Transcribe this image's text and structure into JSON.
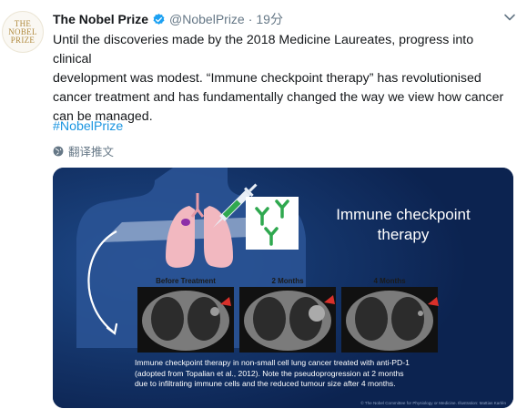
{
  "tweet": {
    "avatar_lines": [
      "THE",
      "NOBEL",
      "PRIZE"
    ],
    "display_name": "The Nobel Prize",
    "handle": "@NobelPrize",
    "separator": "·",
    "time": "19分",
    "text_lines": [
      "Until the discoveries made by the 2018 Medicine Laureates, progress into clinical",
      "development was modest. “Immune checkpoint therapy” has revolutionised",
      "cancer treatment and has fundamentally changed the way we view how cancer",
      "can be managed."
    ],
    "hashtag": "#NobelPrize",
    "translate_label": "翻译推文",
    "colors": {
      "link": "#1b95e0",
      "muted": "#657786",
      "media_bg": "#0f2a5a",
      "avatar_gold": "#b08a3e"
    }
  },
  "media": {
    "title_lines": [
      "Immune checkpoint",
      "therapy"
    ],
    "scans": [
      {
        "label": "Before Treatment"
      },
      {
        "label": "2 Months"
      },
      {
        "label": "4 Months"
      }
    ],
    "caption_lines": [
      "Immune checkpoint therapy in non-small cell lung cancer treated with anti-PD-1",
      "(adopted from Topalian et al., 2012). Note the pseudoprogression at 2 months",
      "due to infiltrating immune cells and the reduced tumour size after 4 months."
    ],
    "credit": "© The Nobel Committee for Physiology or Medicine. Illustration: Mattias Karlén"
  }
}
